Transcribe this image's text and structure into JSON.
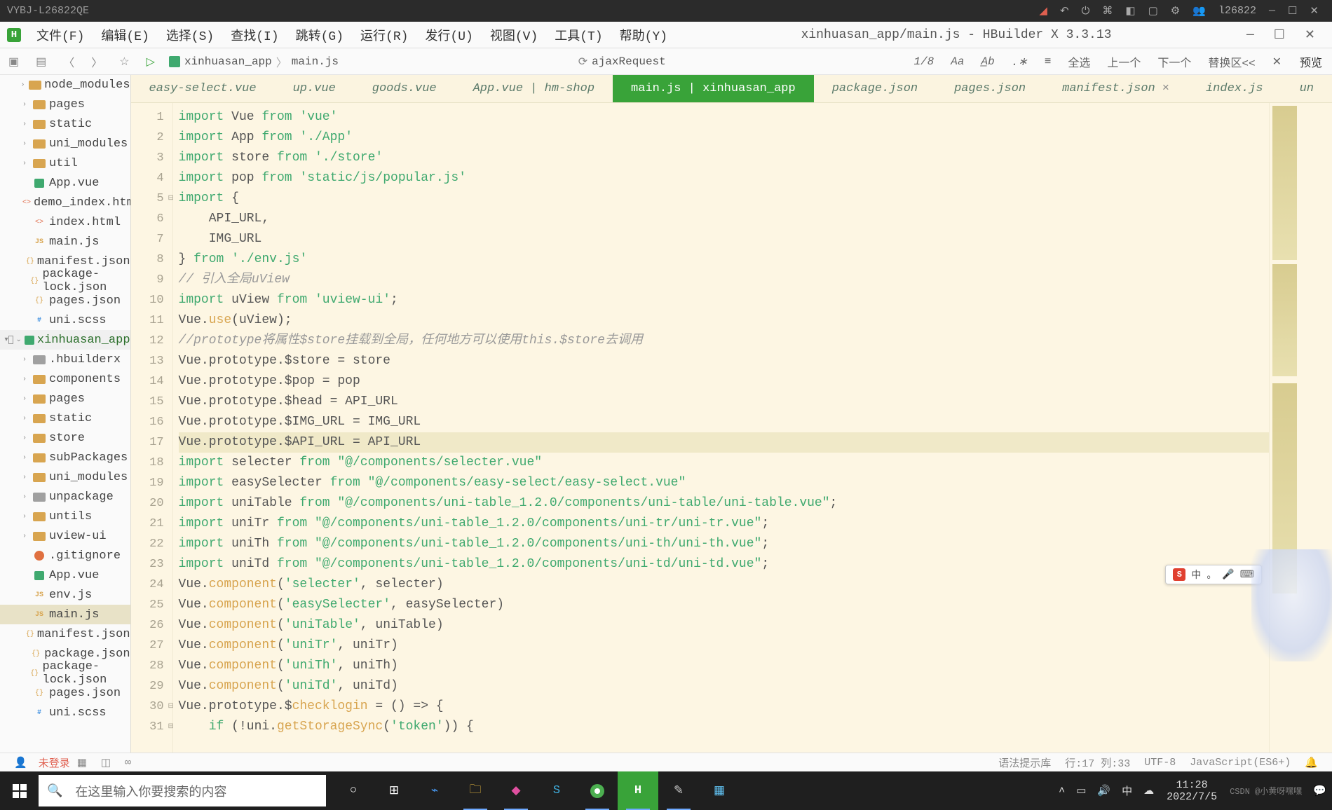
{
  "os": {
    "title": "VYBJ-L26822QE",
    "user": "l26822"
  },
  "menu": {
    "items": [
      "文件(F)",
      "编辑(E)",
      "选择(S)",
      "查找(I)",
      "跳转(G)",
      "运行(R)",
      "发行(U)",
      "视图(V)",
      "工具(T)",
      "帮助(Y)"
    ],
    "title": "xinhuasan_app/main.js - HBuilder X 3.3.13"
  },
  "toolbar": {
    "breadcrumb": [
      "xinhuasan_app",
      "main.js"
    ],
    "ajax": "ajaxRequest",
    "counter": "1/8",
    "nav": [
      "全选",
      "上一个",
      "下一个",
      "替换区<<"
    ],
    "preview": "预览"
  },
  "tabs": [
    {
      "label": "easy-select.vue"
    },
    {
      "label": "up.vue"
    },
    {
      "label": "goods.vue"
    },
    {
      "label": "App.vue | hm-shop"
    },
    {
      "label": "main.js | xinhuasan_app",
      "active": true
    },
    {
      "label": "package.json"
    },
    {
      "label": "pages.json"
    },
    {
      "label": "manifest.json",
      "close": true
    },
    {
      "label": "index.js"
    },
    {
      "label": "un"
    }
  ],
  "tree": [
    {
      "d": 1,
      "t": "folder",
      "n": "node_modules",
      "c": true
    },
    {
      "d": 1,
      "t": "folder",
      "n": "pages",
      "c": true
    },
    {
      "d": 1,
      "t": "folder",
      "n": "static",
      "c": true
    },
    {
      "d": 1,
      "t": "folder",
      "n": "uni_modules",
      "c": true
    },
    {
      "d": 1,
      "t": "folder",
      "n": "util",
      "c": true
    },
    {
      "d": 1,
      "t": "vue",
      "n": "App.vue"
    },
    {
      "d": 1,
      "t": "html",
      "n": "demo_index.html"
    },
    {
      "d": 1,
      "t": "html",
      "n": "index.html"
    },
    {
      "d": 1,
      "t": "js",
      "n": "main.js"
    },
    {
      "d": 1,
      "t": "json",
      "n": "manifest.json"
    },
    {
      "d": 1,
      "t": "json",
      "n": "package-lock.json"
    },
    {
      "d": 1,
      "t": "json",
      "n": "pages.json"
    },
    {
      "d": 1,
      "t": "scss",
      "n": "uni.scss"
    },
    {
      "d": 0,
      "t": "proj",
      "n": "xinhuasan_app",
      "open": true,
      "chk": true
    },
    {
      "d": 1,
      "t": "folderg",
      "n": ".hbuilderx",
      "c": true
    },
    {
      "d": 1,
      "t": "folder",
      "n": "components",
      "c": true
    },
    {
      "d": 1,
      "t": "folder",
      "n": "pages",
      "c": true
    },
    {
      "d": 1,
      "t": "folder",
      "n": "static",
      "c": true
    },
    {
      "d": 1,
      "t": "folder",
      "n": "store",
      "c": true
    },
    {
      "d": 1,
      "t": "folder",
      "n": "subPackages",
      "c": true
    },
    {
      "d": 1,
      "t": "folder",
      "n": "uni_modules",
      "c": true
    },
    {
      "d": 1,
      "t": "folderg",
      "n": "unpackage",
      "c": true
    },
    {
      "d": 1,
      "t": "folder",
      "n": "untils",
      "c": true
    },
    {
      "d": 1,
      "t": "folder",
      "n": "uview-ui",
      "c": true
    },
    {
      "d": 1,
      "t": "git",
      "n": ".gitignore"
    },
    {
      "d": 1,
      "t": "vue",
      "n": "App.vue"
    },
    {
      "d": 1,
      "t": "js",
      "n": "env.js"
    },
    {
      "d": 1,
      "t": "js",
      "n": "main.js",
      "sel": true
    },
    {
      "d": 1,
      "t": "json",
      "n": "manifest.json"
    },
    {
      "d": 1,
      "t": "json",
      "n": "package.json"
    },
    {
      "d": 1,
      "t": "json",
      "n": "package-lock.json"
    },
    {
      "d": 1,
      "t": "json",
      "n": "pages.json"
    },
    {
      "d": 1,
      "t": "scss",
      "n": "uni.scss"
    }
  ],
  "code": [
    [
      {
        "k": "kw",
        "t": "import"
      },
      {
        "t": " Vue "
      },
      {
        "k": "kw",
        "t": "from"
      },
      {
        "t": " "
      },
      {
        "k": "str",
        "t": "'vue'"
      }
    ],
    [
      {
        "k": "kw",
        "t": "import"
      },
      {
        "t": " App "
      },
      {
        "k": "kw",
        "t": "from"
      },
      {
        "t": " "
      },
      {
        "k": "str",
        "t": "'./App'"
      }
    ],
    [
      {
        "k": "kw",
        "t": "import"
      },
      {
        "t": " store "
      },
      {
        "k": "kw",
        "t": "from"
      },
      {
        "t": " "
      },
      {
        "k": "str",
        "t": "'./store'"
      }
    ],
    [
      {
        "k": "kw",
        "t": "import"
      },
      {
        "t": " pop "
      },
      {
        "k": "kw",
        "t": "from"
      },
      {
        "t": " "
      },
      {
        "k": "str",
        "t": "'static/js/popular.js'"
      }
    ],
    [
      {
        "k": "kw",
        "t": "import"
      },
      {
        "t": " {"
      }
    ],
    [
      {
        "t": "    API_URL,"
      }
    ],
    [
      {
        "t": "    IMG_URL"
      }
    ],
    [
      {
        "t": "} "
      },
      {
        "k": "kw",
        "t": "from"
      },
      {
        "t": " "
      },
      {
        "k": "str",
        "t": "'./env.js'"
      }
    ],
    [
      {
        "k": "cm",
        "t": "// 引入全局uView"
      }
    ],
    [
      {
        "k": "kw",
        "t": "import"
      },
      {
        "t": " uView "
      },
      {
        "k": "kw",
        "t": "from"
      },
      {
        "t": " "
      },
      {
        "k": "str",
        "t": "'uview-ui'"
      },
      {
        "t": ";"
      }
    ],
    [
      {
        "t": "Vue."
      },
      {
        "k": "fn",
        "t": "use"
      },
      {
        "t": "(uView);"
      }
    ],
    [
      {
        "k": "cm",
        "t": "//prototype将属性$store挂载到全局，任何地方可以使用this.$store去调用"
      }
    ],
    [
      {
        "t": "Vue.prototype.$store = store"
      }
    ],
    [
      {
        "t": "Vue.prototype.$pop = pop"
      }
    ],
    [
      {
        "t": "Vue.prototype.$head = API_URL"
      }
    ],
    [
      {
        "t": "Vue.prototype.$IMG_URL = IMG_URL"
      }
    ],
    [
      {
        "t": "Vue.prototype.$API_URL = API_URL"
      }
    ],
    [
      {
        "k": "kw",
        "t": "import"
      },
      {
        "t": " selecter "
      },
      {
        "k": "kw",
        "t": "from"
      },
      {
        "t": " "
      },
      {
        "k": "str",
        "t": "\"@/components/selecter.vue\""
      }
    ],
    [
      {
        "k": "kw",
        "t": "import"
      },
      {
        "t": " easySelecter "
      },
      {
        "k": "kw",
        "t": "from"
      },
      {
        "t": " "
      },
      {
        "k": "str",
        "t": "\"@/components/easy-select/easy-select.vue\""
      }
    ],
    [
      {
        "k": "kw",
        "t": "import"
      },
      {
        "t": " uniTable "
      },
      {
        "k": "kw",
        "t": "from"
      },
      {
        "t": " "
      },
      {
        "k": "str",
        "t": "\"@/components/uni-table_1.2.0/components/uni-table/uni-table.vue\""
      },
      {
        "t": ";"
      }
    ],
    [
      {
        "k": "kw",
        "t": "import"
      },
      {
        "t": " uniTr "
      },
      {
        "k": "kw",
        "t": "from"
      },
      {
        "t": " "
      },
      {
        "k": "str",
        "t": "\"@/components/uni-table_1.2.0/components/uni-tr/uni-tr.vue\""
      },
      {
        "t": ";"
      }
    ],
    [
      {
        "k": "kw",
        "t": "import"
      },
      {
        "t": " uniTh "
      },
      {
        "k": "kw",
        "t": "from"
      },
      {
        "t": " "
      },
      {
        "k": "str",
        "t": "\"@/components/uni-table_1.2.0/components/uni-th/uni-th.vue\""
      },
      {
        "t": ";"
      }
    ],
    [
      {
        "k": "kw",
        "t": "import"
      },
      {
        "t": " uniTd "
      },
      {
        "k": "kw",
        "t": "from"
      },
      {
        "t": " "
      },
      {
        "k": "str",
        "t": "\"@/components/uni-table_1.2.0/components/uni-td/uni-td.vue\""
      },
      {
        "t": ";"
      }
    ],
    [
      {
        "t": "Vue."
      },
      {
        "k": "fn",
        "t": "component"
      },
      {
        "t": "("
      },
      {
        "k": "str",
        "t": "'selecter'"
      },
      {
        "t": ", selecter)"
      }
    ],
    [
      {
        "t": "Vue."
      },
      {
        "k": "fn",
        "t": "component"
      },
      {
        "t": "("
      },
      {
        "k": "str",
        "t": "'easySelecter'"
      },
      {
        "t": ", easySelecter)"
      }
    ],
    [
      {
        "t": "Vue."
      },
      {
        "k": "fn",
        "t": "component"
      },
      {
        "t": "("
      },
      {
        "k": "str",
        "t": "'uniTable'"
      },
      {
        "t": ", uniTable)"
      }
    ],
    [
      {
        "t": "Vue."
      },
      {
        "k": "fn",
        "t": "component"
      },
      {
        "t": "("
      },
      {
        "k": "str",
        "t": "'uniTr'"
      },
      {
        "t": ", uniTr)"
      }
    ],
    [
      {
        "t": "Vue."
      },
      {
        "k": "fn",
        "t": "component"
      },
      {
        "t": "("
      },
      {
        "k": "str",
        "t": "'uniTh'"
      },
      {
        "t": ", uniTh)"
      }
    ],
    [
      {
        "t": "Vue."
      },
      {
        "k": "fn",
        "t": "component"
      },
      {
        "t": "("
      },
      {
        "k": "str",
        "t": "'uniTd'"
      },
      {
        "t": ", uniTd)"
      }
    ],
    [
      {
        "t": "Vue.prototype.$"
      },
      {
        "k": "fn",
        "t": "checklogin"
      },
      {
        "t": " = () => {"
      }
    ],
    [
      {
        "t": "    "
      },
      {
        "k": "kw",
        "t": "if"
      },
      {
        "t": " (!uni."
      },
      {
        "k": "fn",
        "t": "getStorageSync"
      },
      {
        "t": "("
      },
      {
        "k": "str",
        "t": "'token'"
      },
      {
        "t": ")) {"
      }
    ]
  ],
  "highlight_line": 17,
  "status": {
    "login": "未登录",
    "hint": "语法提示库",
    "cursor": "行:17 列:33",
    "encoding": "UTF-8",
    "lang": "JavaScript(ES6+)"
  },
  "taskbar": {
    "search_placeholder": "在这里输入你要搜索的内容",
    "clock_time": "11:28",
    "clock_date": "2022/7/5",
    "watermark": "CSDN @小黄呀嘿嘿"
  },
  "ime": {
    "label": "中"
  }
}
